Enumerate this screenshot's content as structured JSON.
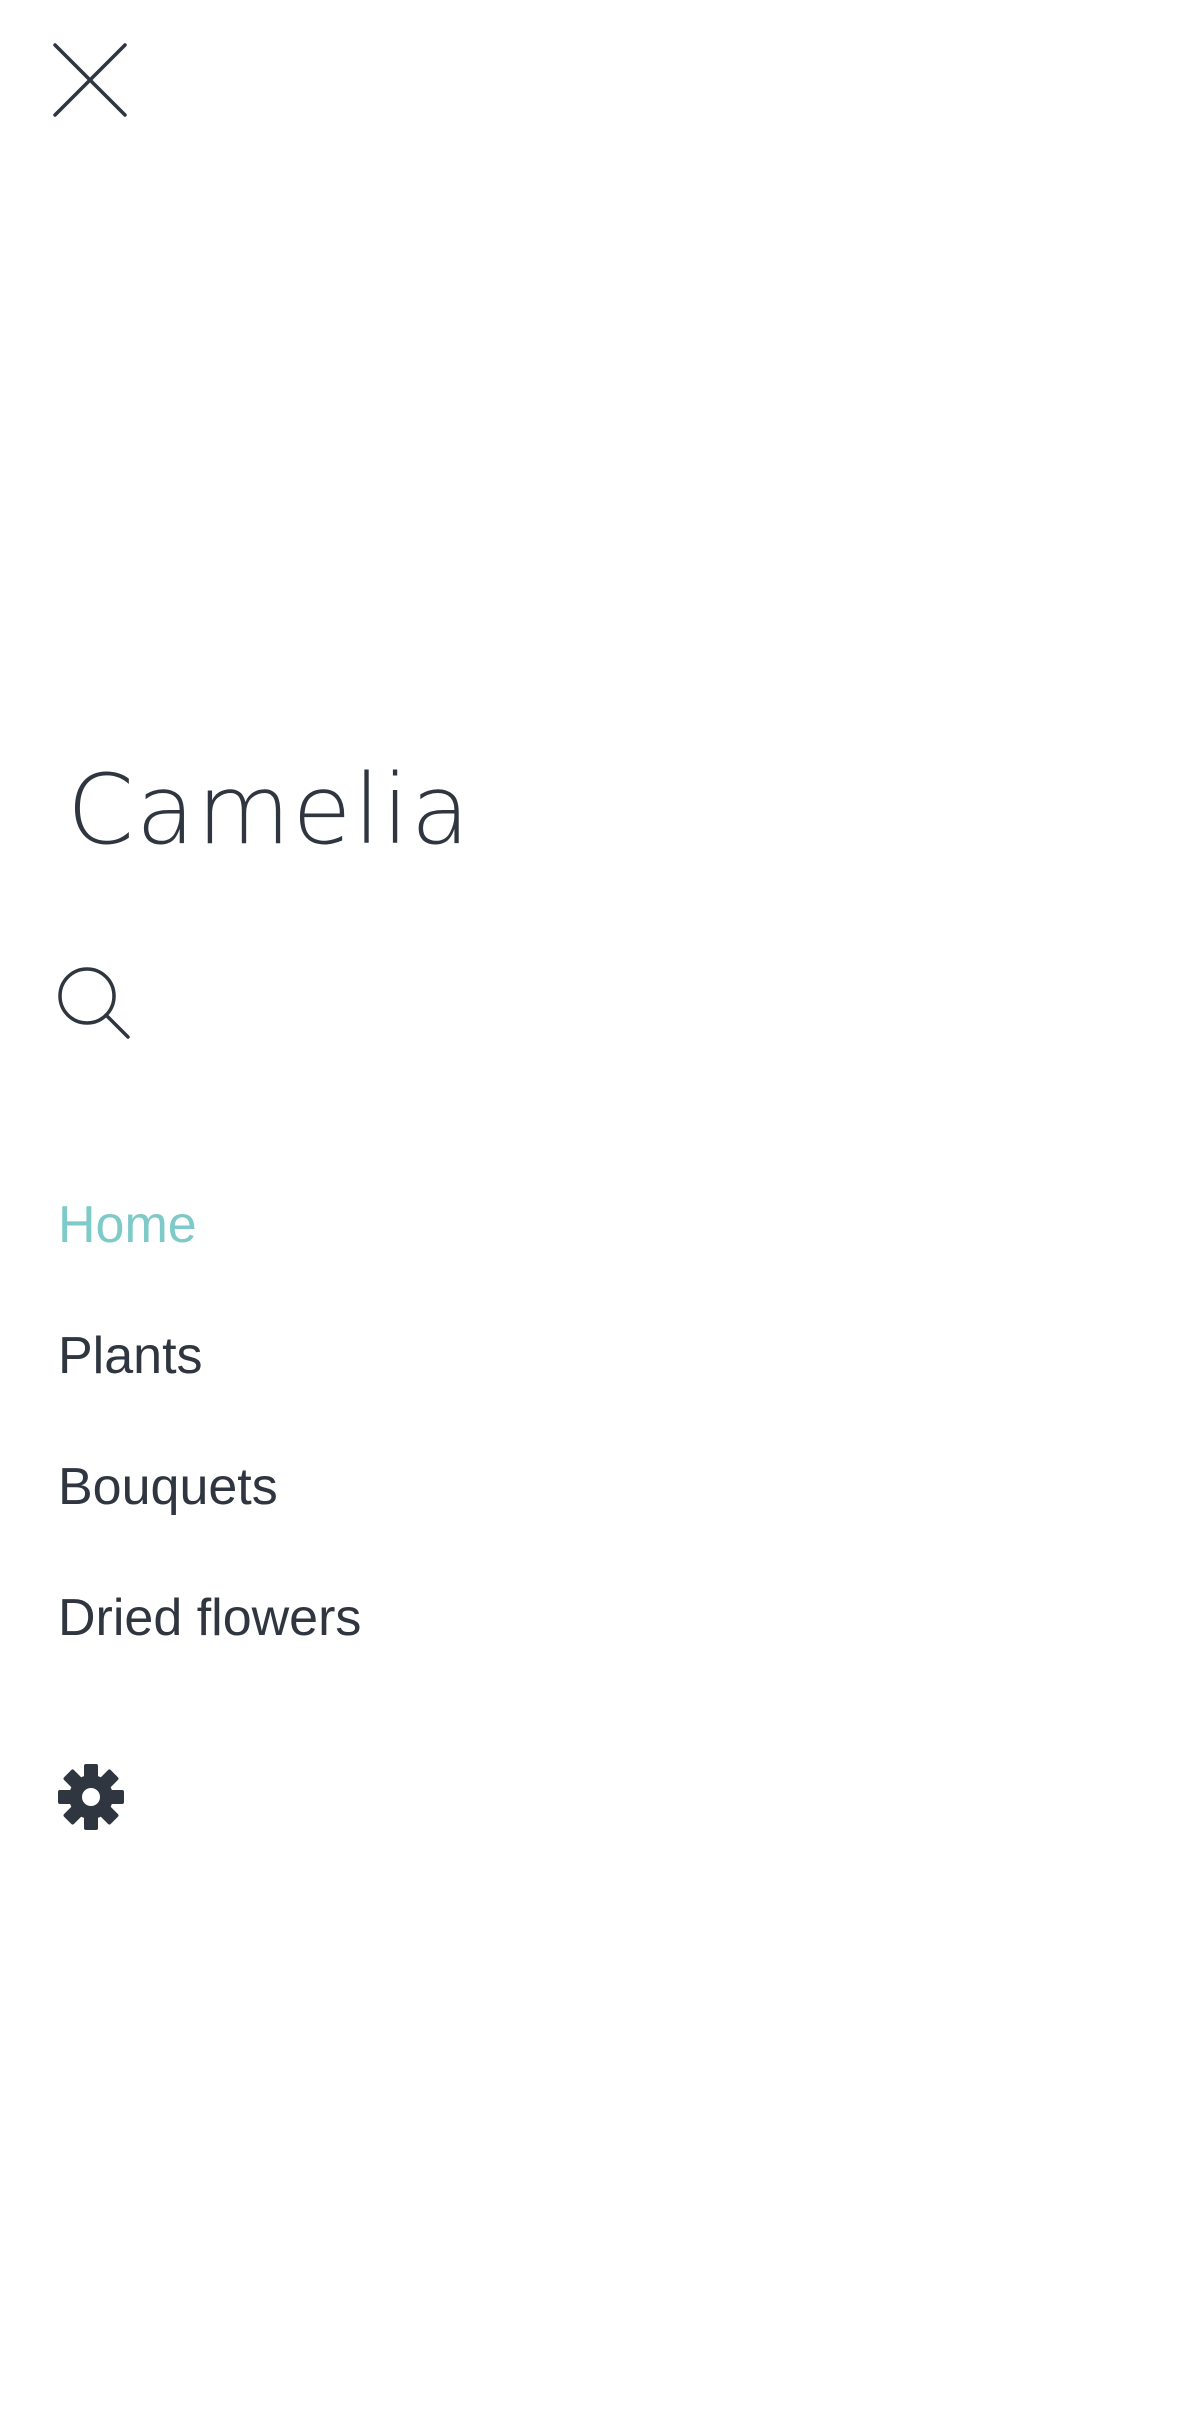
{
  "menu": {
    "close_icon": "close-icon",
    "brand": "Camelia",
    "search_icon": "search-icon",
    "items": [
      {
        "label": "Home",
        "active": true
      },
      {
        "label": "Plants",
        "active": false
      },
      {
        "label": "Bouquets",
        "active": false
      },
      {
        "label": "Dried flowers",
        "active": false
      }
    ],
    "settings_icon": "gear-icon"
  },
  "colors": {
    "text": "#2f3640",
    "accent": "#7ecac8",
    "background": "#ffffff"
  }
}
